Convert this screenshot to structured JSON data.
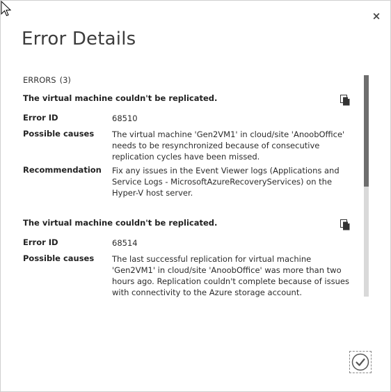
{
  "dialog": {
    "title": "Error Details",
    "close_glyph": "×"
  },
  "errors": {
    "label": "ERRORS",
    "count": "(3)",
    "items": [
      {
        "title": "The virtual machine couldn't be replicated.",
        "error_id_label": "Error ID",
        "error_id": "68510",
        "causes_label": "Possible causes",
        "causes": "The virtual machine 'Gen2VM1' in cloud/site 'AnoobOffice' needs to be resynchronized because of consecutive replication cycles have been missed.",
        "recommendation_label": "Recommendation",
        "recommendation": "Fix any issues in the Event Viewer logs (Applications and Service Logs - MicrosoftAzureRecoveryServices) on the Hyper-V host server."
      },
      {
        "title": "The virtual machine couldn't be replicated.",
        "error_id_label": "Error ID",
        "error_id": "68514",
        "causes_label": "Possible causes",
        "causes": "The last successful replication for virtual machine 'Gen2VM1' in cloud/site 'AnoobOffice' was more than two hours ago. Replication couldn't complete because of issues with connectivity to the Azure storage account."
      }
    ]
  },
  "icons": {
    "close": "close-icon",
    "copy": "copy-icon",
    "ok": "checkmark-icon",
    "cursor": "mouse-pointer-icon"
  },
  "colors": {
    "scroll_thumb": "#6e6e6e",
    "scroll_track": "#d9d9d9",
    "text": "#2b2b2b"
  }
}
